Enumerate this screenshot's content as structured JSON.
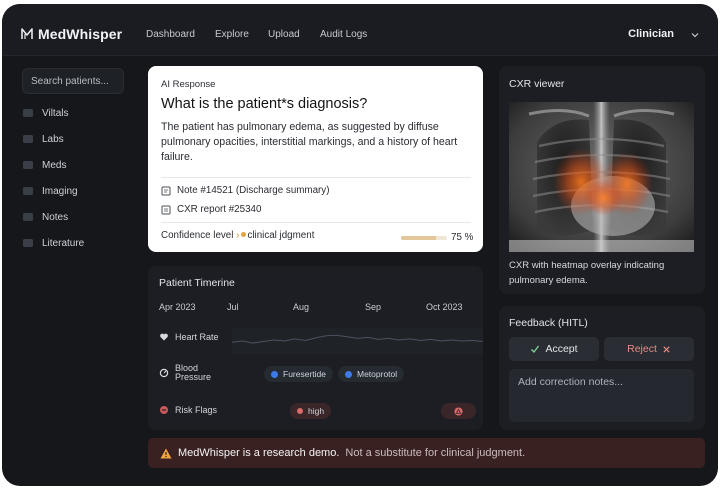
{
  "app": {
    "name": "MedWhisper"
  },
  "nav": {
    "links": [
      "Dashboard",
      "Explore",
      "Upload",
      "Audit Logs"
    ],
    "role": "Clinician"
  },
  "sidebar": {
    "search_placeholder": "Search patients...",
    "items": [
      {
        "label": "Viltals",
        "icon": "vitals-icon"
      },
      {
        "label": "Labs",
        "icon": "labs-icon"
      },
      {
        "label": "Meds",
        "icon": "meds-icon"
      },
      {
        "label": "Imaging",
        "icon": "imaging-icon"
      },
      {
        "label": "Notes",
        "icon": "notes-icon"
      },
      {
        "label": "Literature",
        "icon": "literature-icon"
      }
    ]
  },
  "ai_response": {
    "kicker": "AI Response",
    "question": "What is the patient*s diagnosis?",
    "answer": "The patient has pulmonary edema, as suggested by diffuse pulmonary opacities, interstitial markings, and a history of heart failure.",
    "sources": [
      {
        "label": "Note #14521  (Discharge summary)",
        "icon": "note-icon"
      },
      {
        "label": "CXR report #25340",
        "icon": "report-icon"
      }
    ],
    "confidence": {
      "label": "Confidence level",
      "qualifier": "clinical jdgment",
      "percent_label": "75 %",
      "value": 0.75
    }
  },
  "timeline": {
    "title": "Patient Timerine",
    "months": [
      "Apr 2023",
      "Jul",
      "Aug",
      "Sep",
      "Oct 2023"
    ],
    "rows": [
      {
        "label": "Heart Rate",
        "icon": "heart-icon"
      },
      {
        "label": "Blood\nPressure",
        "icon": "pressure-icon"
      },
      {
        "label": "Risk Flags",
        "icon": "risk-icon"
      }
    ],
    "meds": [
      {
        "label": "Furesertide",
        "color": "#3d7bea"
      },
      {
        "label": "Metoprotol",
        "color": "#3d7bea"
      }
    ],
    "risk_pill": {
      "label": "high",
      "color": "#d96b6b"
    },
    "heart_rate_series": [
      0.55,
      0.5,
      0.58,
      0.52,
      0.46,
      0.5,
      0.42,
      0.48,
      0.38,
      0.3,
      0.28,
      0.34,
      0.4,
      0.36,
      0.44,
      0.4,
      0.46,
      0.42,
      0.48,
      0.44,
      0.5,
      0.46,
      0.5,
      0.48,
      0.52
    ]
  },
  "cxr": {
    "title": "CXR viewer",
    "caption": "CXR with heatmap overlay indicating pulmonary edema."
  },
  "feedback": {
    "title": "Feedback (HITL)",
    "accept_label": "Accept",
    "reject_label": "Reject",
    "notes_placeholder": "Add correction notes..."
  },
  "banner": {
    "strong": "MedWhisper is a research demo.",
    "rest": "Not a substitute for clinical judgment."
  },
  "colors": {
    "accept": "#7fd39a",
    "reject": "#e58b84",
    "warning": "#f0a541",
    "accent": "#e3a43e"
  }
}
